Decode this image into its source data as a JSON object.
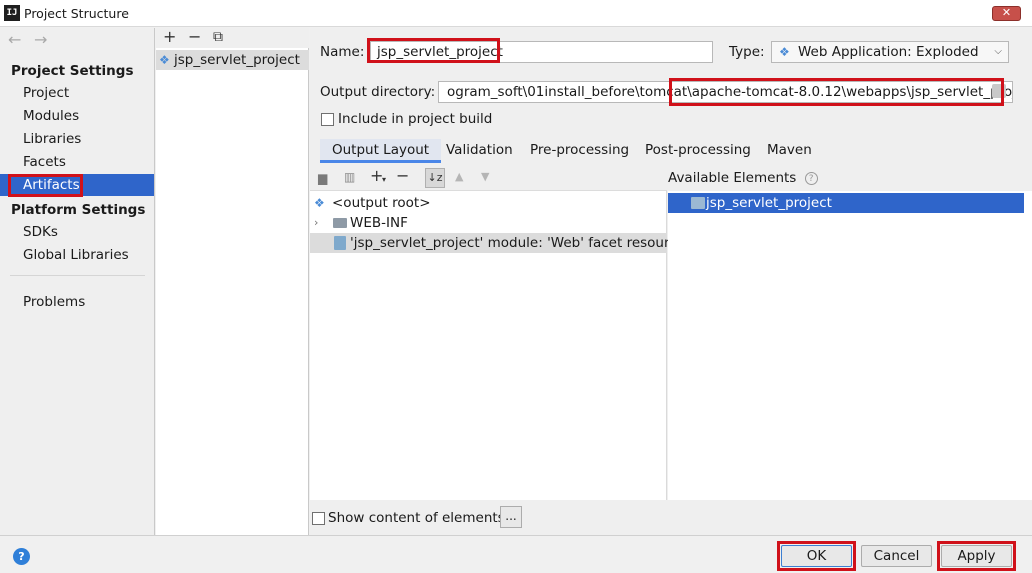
{
  "window": {
    "title": "Project Structure",
    "app_icon": "IJ"
  },
  "nav": {
    "back": "←",
    "forward": "→",
    "project_settings": "Project Settings",
    "items_ps": [
      "Project",
      "Modules",
      "Libraries",
      "Facets",
      "Artifacts"
    ],
    "platform_settings": "Platform Settings",
    "items_platform": [
      "SDKs",
      "Global Libraries"
    ],
    "problems": "Problems",
    "selected": "Artifacts"
  },
  "artifact_list": {
    "add": "+",
    "remove": "−",
    "copy": "⧉",
    "items": [
      "jsp_servlet_project"
    ]
  },
  "form": {
    "name_label": "Name:",
    "name_value": "jsp_servlet_project",
    "type_label": "Type:",
    "type_value": "Web Application: Exploded",
    "output_label": "Output directory:",
    "output_value": "ogram_soft\\01install_before\\tomcat\\apache-tomcat-8.0.12\\webapps\\jsp_servlet_project",
    "include_build_label": "Include in project build",
    "include_build_checked": false
  },
  "tabs": [
    "Output Layout",
    "Validation",
    "Pre-processing",
    "Post-processing",
    "Maven"
  ],
  "active_tab": "Output Layout",
  "layout_tree": {
    "root": "<output root>",
    "webinf": "WEB-INF",
    "module_res": "'jsp_servlet_project' module: 'Web' facet resources"
  },
  "available": {
    "header": "Available Elements",
    "items": [
      "jsp_servlet_project"
    ]
  },
  "show_content_label": "Show content of elements",
  "ellipsis": "...",
  "buttons": {
    "ok": "OK",
    "cancel": "Cancel",
    "apply": "Apply"
  },
  "help": "?",
  "colors": {
    "selection": "#2f65ca",
    "highlight": "#d0111a"
  }
}
